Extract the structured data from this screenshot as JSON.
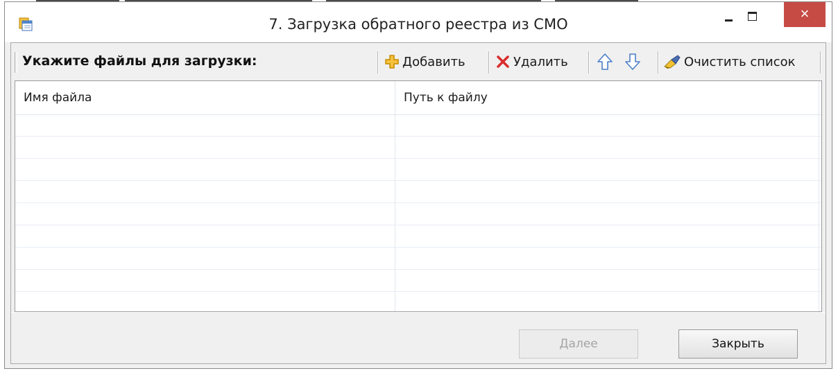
{
  "window": {
    "title": "7. Загрузка обратного реестра из СМО",
    "close_glyph": "×"
  },
  "toolbar": {
    "label": "Укажите файлы для загрузки:",
    "add_label": "Добавить",
    "delete_label": "Удалить",
    "clear_label": "Очистить список"
  },
  "table": {
    "columns": [
      "Имя файла",
      "Путь к файлу"
    ],
    "rows": []
  },
  "footer": {
    "next_label": "Далее",
    "close_label": "Закрыть"
  },
  "icons": {
    "app": "form-window-icon",
    "add": "plus-icon",
    "delete": "red-x-icon",
    "up": "arrow-up-icon",
    "down": "arrow-down-icon",
    "clear": "eraser-brush-icon"
  },
  "colors": {
    "close_button": "#c74b45",
    "add_icon": "#e8a400",
    "delete_icon": "#d92b2b",
    "arrow_icon": "#4a7fc8"
  }
}
